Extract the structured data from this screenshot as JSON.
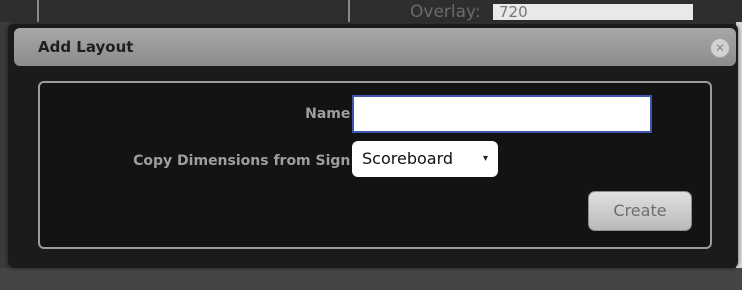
{
  "background": {
    "overlay_label": "Overlay:",
    "overlay_value": "720"
  },
  "dialog": {
    "title": "Add Layout",
    "close_icon": "close-icon",
    "close_glyph": "✕",
    "fields": {
      "name_label": "Name:",
      "name_value": "",
      "copy_label": "Copy Dimensions from Sign:",
      "copy_selected": "Scoreboard",
      "caret_glyph": "▾"
    },
    "create_label": "Create"
  }
}
